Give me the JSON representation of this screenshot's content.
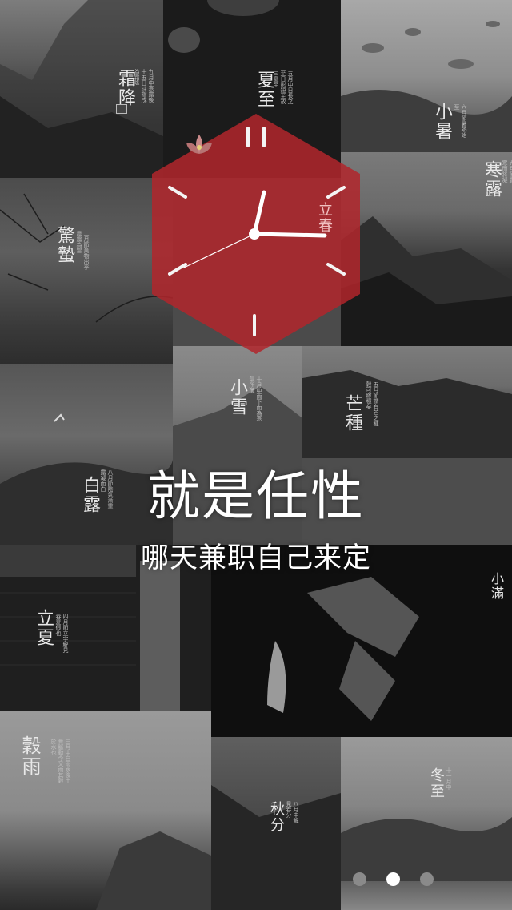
{
  "hero": {
    "title": "就是任性",
    "subtitle": "哪天兼职自己来定"
  },
  "colors": {
    "accent": "#b2262b",
    "dot_active": "#ffffff",
    "dot_inactive": "#8a8a8a"
  },
  "clock_icon": "clock-icon",
  "tiles": [
    {
      "title": "霜降",
      "caption": "九月中寒露後十五日斗指戌為霜降"
    },
    {
      "title": "夏至",
      "caption": "五月中日長之至日影短至故曰夏至"
    },
    {
      "title": "小暑",
      "caption": "六月節暑熱始至"
    },
    {
      "title": "寒露",
      "caption": "九月節露寒而將凝"
    },
    {
      "title": "立春",
      "caption": ""
    },
    {
      "title": "驚蟄",
      "caption": "二月節萬物出乎震震為雷"
    },
    {
      "title": "小雪",
      "caption": "十月中雨下而為寒氣所薄"
    },
    {
      "title": "芒種",
      "caption": "五月節謂有芒之種穀可稼種矣"
    },
    {
      "title": "白露",
      "caption": "八月節陰氣漸重露凝而白"
    },
    {
      "title": "小滿",
      "caption": ""
    },
    {
      "title": "立夏",
      "caption": "四月節立字解見春夏假也"
    },
    {
      "title": "穀雨",
      "caption": "三月中自雨水後土膏脈動今又雨其穀於水也"
    },
    {
      "title": "秋分",
      "caption": "八月中解見春分"
    },
    {
      "title": "冬至",
      "caption": "十一月中"
    }
  ],
  "pager": {
    "count": 3,
    "active": 1
  }
}
